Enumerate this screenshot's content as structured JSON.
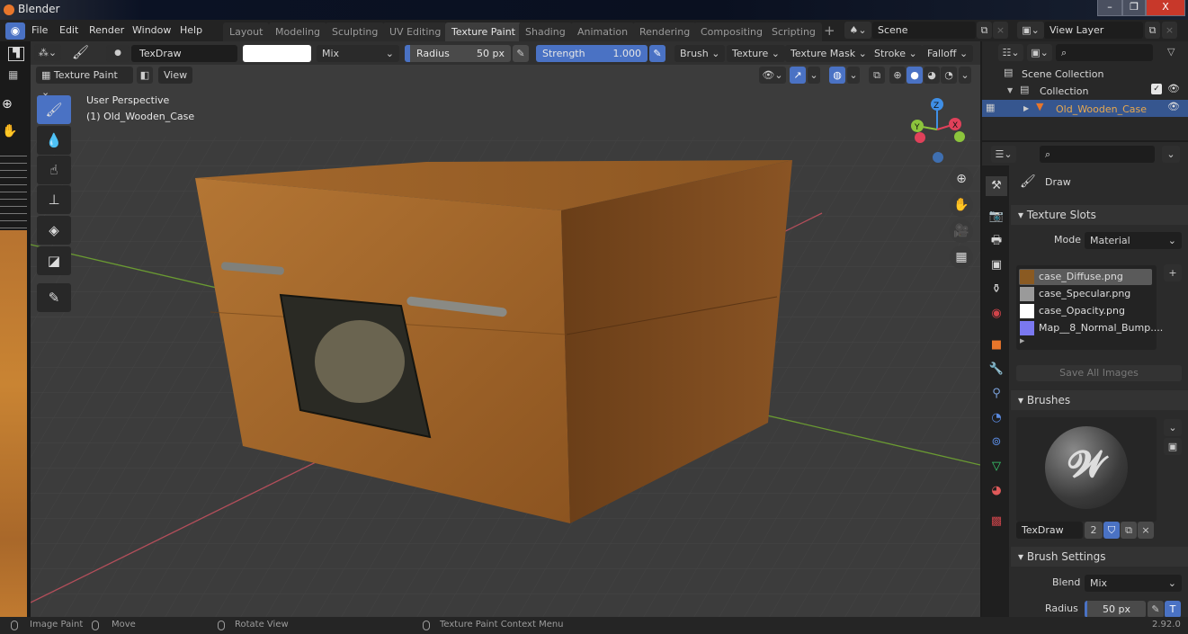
{
  "window": {
    "title": "Blender",
    "minimize": "–",
    "maximize": "❐",
    "close": "X"
  },
  "menu": {
    "items": [
      "File",
      "Edit",
      "Render",
      "Window",
      "Help"
    ]
  },
  "workspaces": [
    {
      "label": "Layout",
      "active": false
    },
    {
      "label": "Modeling",
      "active": false
    },
    {
      "label": "Sculpting",
      "active": false
    },
    {
      "label": "UV Editing",
      "active": false
    },
    {
      "label": "Texture Paint",
      "active": true
    },
    {
      "label": "Shading",
      "active": false
    },
    {
      "label": "Animation",
      "active": false
    },
    {
      "label": "Rendering",
      "active": false
    },
    {
      "label": "Compositing",
      "active": false
    },
    {
      "label": "Scripting",
      "active": false
    }
  ],
  "add_workspace": "+",
  "scene": {
    "value": "Scene"
  },
  "view_layer": {
    "value": "View Layer"
  },
  "tool_header": {
    "brush_name": "TexDraw",
    "color_hex": "#ffffff",
    "blend": "Mix",
    "radius_label": "Radius",
    "radius_value": "50 px",
    "strength_label": "Strength",
    "strength_value": "1.000",
    "menus": [
      "Brush",
      "Texture",
      "Texture Mask",
      "Stroke",
      "Falloff"
    ]
  },
  "viewport_header": {
    "mode": "Texture Paint",
    "view": "View"
  },
  "viewport": {
    "perspective": "User Perspective",
    "object_label": "(1) Old_Wooden_Case",
    "gizmo": {
      "z": "Z",
      "y": "Y",
      "x": "X"
    },
    "colors": {
      "x_axis": "#e0415a",
      "y_axis": "#8cc43c",
      "z_axis": "#3f8fe6",
      "wood": "#a86a2a"
    }
  },
  "tools": [
    "draw",
    "soften",
    "smear",
    "clone",
    "fill",
    "mask",
    "annotate"
  ],
  "outliner": {
    "scene_collection": "Scene Collection",
    "collection": "Collection",
    "object": "Old_Wooden_Case"
  },
  "properties": {
    "tool_name": "Draw",
    "texture_slots": {
      "title": "Texture Slots",
      "mode_label": "Mode",
      "mode_value": "Material",
      "slots": [
        {
          "name": "case_Diffuse.png",
          "swatch": "#8a5a22",
          "selected": true
        },
        {
          "name": "case_Specular.png",
          "swatch": "#9a9a9a",
          "selected": false
        },
        {
          "name": "case_Opacity.png",
          "swatch": "#ffffff",
          "selected": false
        },
        {
          "name": "Map__8_Normal_Bump....",
          "swatch": "#7a78f0",
          "selected": false
        }
      ],
      "save_all": "Save All Images"
    },
    "brushes": {
      "title": "Brushes",
      "brush_name": "TexDraw",
      "users": "2"
    },
    "brush_settings": {
      "title": "Brush Settings",
      "blend_label": "Blend",
      "blend_value": "Mix",
      "radius_label": "Radius",
      "radius_value": "50 px"
    }
  },
  "statusbar": {
    "items": [
      "Image Paint",
      "Move",
      "Rotate View",
      "Texture Paint Context Menu"
    ],
    "version": "2.92.0"
  }
}
